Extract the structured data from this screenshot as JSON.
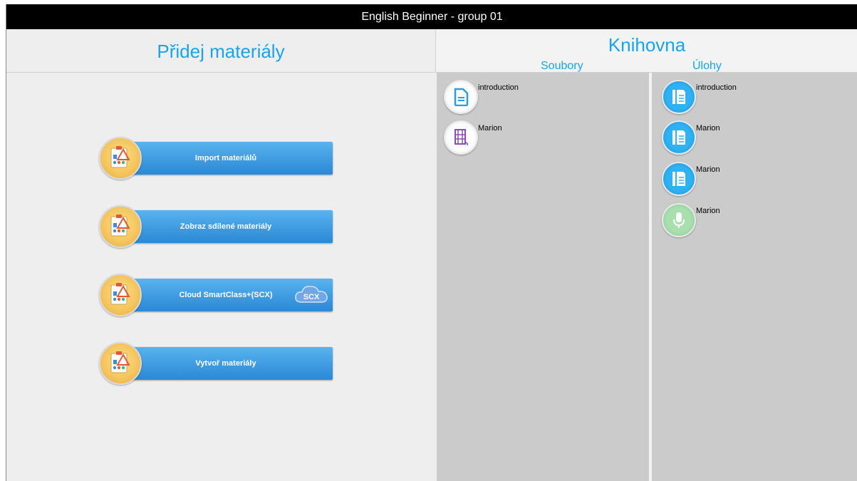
{
  "window": {
    "title": "English Beginner - group 01"
  },
  "left_panel": {
    "title": "Přidej materiály",
    "buttons": [
      {
        "label": "Import materiálů"
      },
      {
        "label": "Zobraz sdílené materiály"
      },
      {
        "label": "Cloud SmartClass+(SCX)",
        "badge": "SCX"
      },
      {
        "label": "Vytvoř materiály"
      }
    ]
  },
  "library": {
    "title": "Knihovna",
    "files_header": "Soubory",
    "tasks_header": "Úlohy",
    "files": [
      {
        "name": "introduction",
        "icon": "document-icon"
      },
      {
        "name": "Marion",
        "icon": "film-icon"
      }
    ],
    "tasks": [
      {
        "name": "introduction",
        "icon": "task-document-icon"
      },
      {
        "name": "Marion",
        "icon": "task-document-icon"
      },
      {
        "name": "Marion",
        "icon": "task-document-icon"
      },
      {
        "name": "Marion",
        "icon": "microphone-icon"
      }
    ]
  },
  "colors": {
    "accent": "#1aa3e8",
    "button_top": "#59b3ee",
    "button_bottom": "#2b88d5",
    "column_bg": "#cbcbcb",
    "titlebar_bg": "#000000"
  }
}
